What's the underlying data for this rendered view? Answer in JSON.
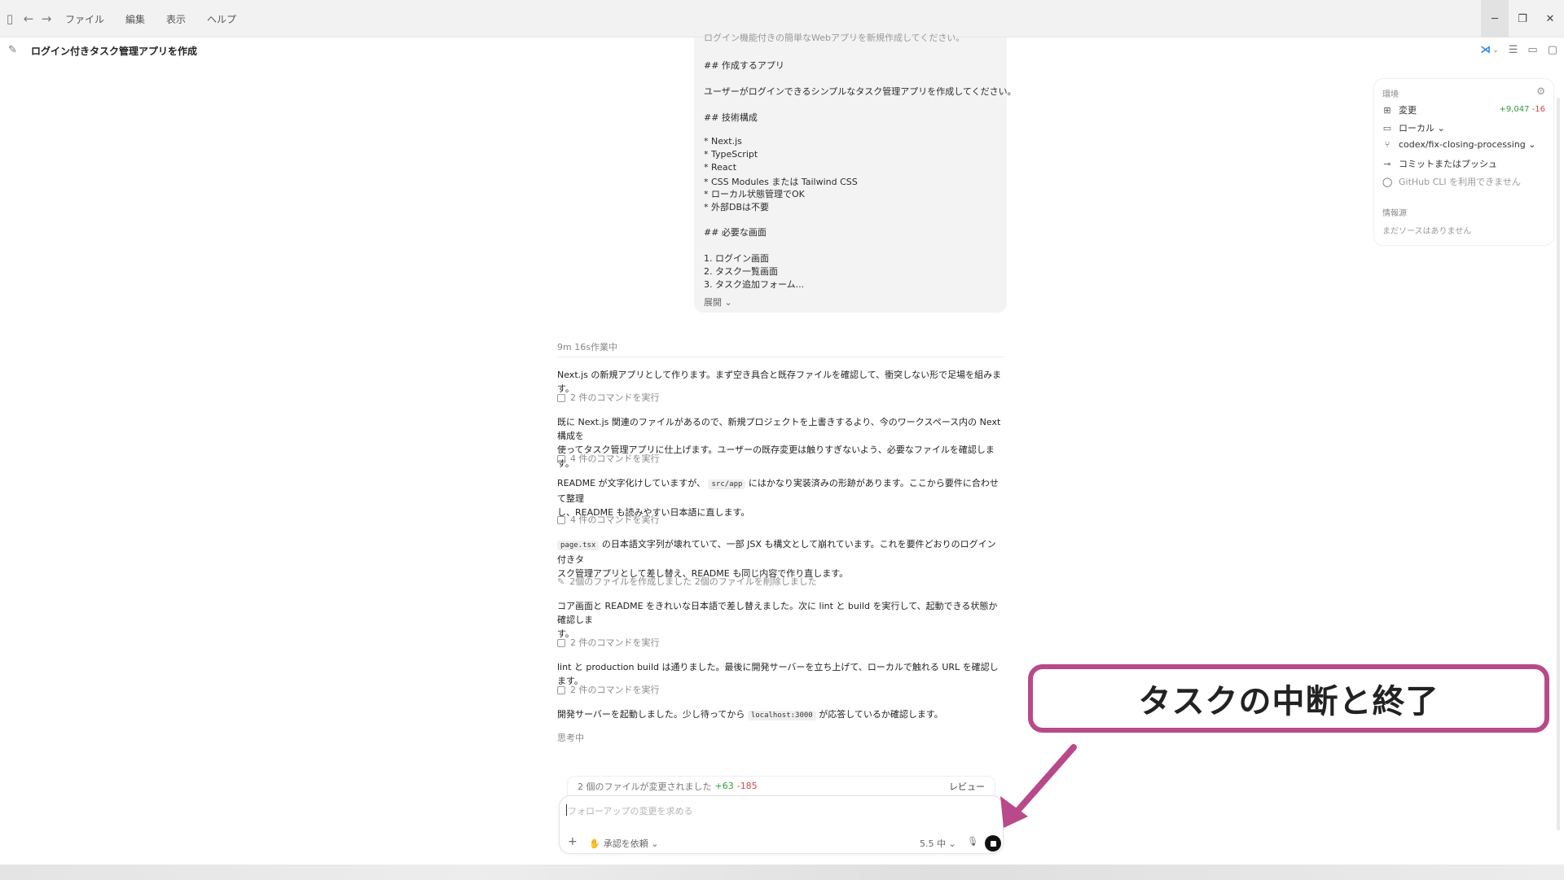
{
  "menu": {
    "file": "ファイル",
    "edit": "編集",
    "view": "表示",
    "help": "ヘルプ"
  },
  "header": {
    "title": "ログイン付きタスク管理アプリを作成",
    "more": "···"
  },
  "prompt": {
    "ghost": "ログイン機能付きの簡単なWebアプリを新規作成してください。",
    "lines": [
      "## 作成するアプリ",
      "ユーザーがログインできるシンプルなタスク管理アプリを作成してください。",
      "## 技術構成",
      "* Next.js",
      "* TypeScript",
      "* React",
      "* CSS Modules または Tailwind CSS",
      "* ローカル状態管理でOK",
      "* 外部DBは不要",
      "## 必要な画面",
      "1. ログイン画面",
      "2. タスク一覧画面",
      "3. タスク追加フォーム..."
    ],
    "expand": "展開 ⌄"
  },
  "conversation": {
    "status": "9m 16s作業中",
    "m1": "Next.js の新規アプリとして作ります。まず空き具合と既存ファイルを確認して、衝突しない形で足場を組みます。",
    "c1": "2 件のコマンドを実行",
    "m2a": "既に Next.js 関連のファイルがあるので、新規プロジェクトを上書きするより、今のワークスペース内の Next 構成を",
    "m2b": "使ってタスク管理アプリに仕上げます。ユーザーの既存変更は触りすぎないよう、必要なファイルを確認します。",
    "c2": "4 件のコマンドを実行",
    "m3a_pre": "README が文字化けしていますが、",
    "m3a_code": "src/app",
    "m3a_post": "にはかなり実装済みの形跡があります。ここから要件に合わせて整理",
    "m3b": "し、README も読みやすい日本語に直します。",
    "c3": "4 件のコマンドを実行",
    "m4a_code": "page.tsx",
    "m4a_post": "の日本語文字列が壊れていて、一部 JSX も構文として崩れています。これを要件どおりのログイン付きタ",
    "m4b": "スク管理アプリとして差し替え、README も同じ内容で作り直します。",
    "files_action": "2個のファイルを作成しました 2個のファイルを削除しました",
    "m5a": "コア画面と README をきれいな日本語で差し替えました。次に lint と build を実行して、起動できる状態か確認しま",
    "m5b": "す。",
    "c4": "2 件のコマンドを実行",
    "m6": "lint と production build は通りました。最後に開発サーバーを立ち上げて、ローカルで触れる URL を確認します。",
    "c5": "2 件のコマンドを実行",
    "m7_pre": "開発サーバーを起動しました。少し待ってから",
    "m7_code": "localhost:3000",
    "m7_post": "が応答しているか確認します。",
    "thinking": "思考中"
  },
  "files_bar": {
    "text": "2 個のファイルが変更されました",
    "added": "+63",
    "removed": "-185",
    "review": "レビュー"
  },
  "composer": {
    "placeholder": "フォローアップの変更を求める",
    "add": "+",
    "approval": "承認を依頼 ⌄",
    "model": "5.5 中 ⌄"
  },
  "side": {
    "env_title": "環境",
    "changes": "変更",
    "changes_added": "+9,047",
    "changes_removed": "-16",
    "local": "ローカル ⌄",
    "branch": "codex/fix-closing-processing ⌄",
    "commit": "コミットまたはプッシュ",
    "github": "GitHub CLI を利用できません",
    "sources_title": "情報源",
    "sources_empty": "まだソースはありません"
  },
  "annotation": {
    "label": "タスクの中断と終了"
  },
  "colors": {
    "accent": "#b8498a",
    "added": "#2e9d3b",
    "removed": "#d64545"
  }
}
